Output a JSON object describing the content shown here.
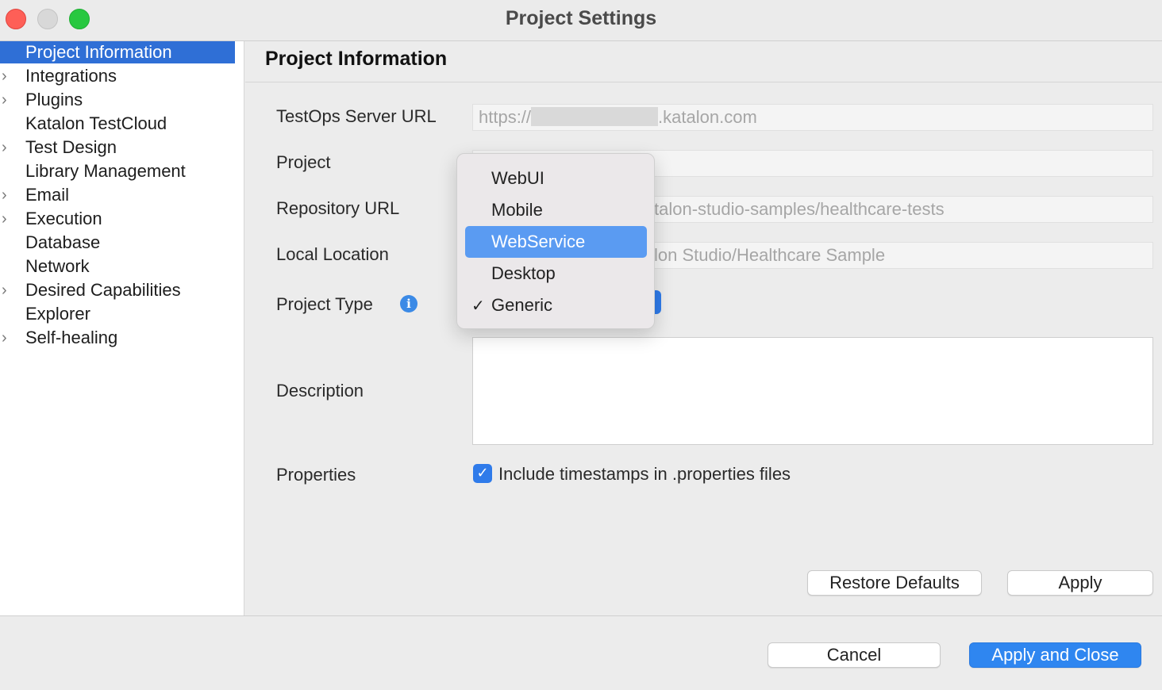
{
  "window": {
    "title": "Project Settings"
  },
  "sidebar": {
    "items": [
      {
        "label": "Project Information",
        "expandable": false,
        "selected": true
      },
      {
        "label": "Integrations",
        "expandable": true
      },
      {
        "label": "Plugins",
        "expandable": true
      },
      {
        "label": "Katalon TestCloud",
        "expandable": false
      },
      {
        "label": "Test Design",
        "expandable": true
      },
      {
        "label": "Library Management",
        "expandable": false
      },
      {
        "label": "Email",
        "expandable": true
      },
      {
        "label": "Execution",
        "expandable": true
      },
      {
        "label": "Database",
        "expandable": false
      },
      {
        "label": "Network",
        "expandable": false
      },
      {
        "label": "Desired Capabilities",
        "expandable": true
      },
      {
        "label": "Explorer",
        "expandable": false
      },
      {
        "label": "Self-healing",
        "expandable": true
      }
    ]
  },
  "main": {
    "title": "Project Information",
    "fields": {
      "testops_label": "TestOps Server URL",
      "testops_prefix": "https://",
      "testops_suffix": ".katalon.com",
      "project_label": "Project",
      "repo_label": "Repository URL",
      "repo_value": "talon-studio-samples/healthcare-tests",
      "local_label": "Local Location",
      "local_value": "lon Studio/Healthcare Sample",
      "type_label": "Project Type",
      "info_glyph": "i",
      "description_label": "Description",
      "properties_label": "Properties",
      "include_timestamps_label": "Include timestamps in .properties files",
      "include_timestamps_checked": true
    },
    "project_type_menu": {
      "options": [
        {
          "label": "WebUI",
          "checked": false,
          "highlighted": false
        },
        {
          "label": "Mobile",
          "checked": false,
          "highlighted": false
        },
        {
          "label": "WebService",
          "checked": false,
          "highlighted": true
        },
        {
          "label": "Desktop",
          "checked": false,
          "highlighted": false
        },
        {
          "label": "Generic",
          "checked": true,
          "highlighted": false
        }
      ],
      "check_glyph": "✓"
    },
    "buttons": {
      "restore_defaults": "Restore Defaults",
      "apply": "Apply"
    }
  },
  "footer": {
    "cancel": "Cancel",
    "apply_and_close": "Apply and Close"
  },
  "colors": {
    "accent": "#2f86f0",
    "selection": "#2f6fd6",
    "menu_highlight": "#5a9bf2"
  },
  "icons": {
    "close": "close-icon",
    "chevron": "chevron-right-icon",
    "info": "info-icon",
    "check": "checkmark-icon"
  }
}
